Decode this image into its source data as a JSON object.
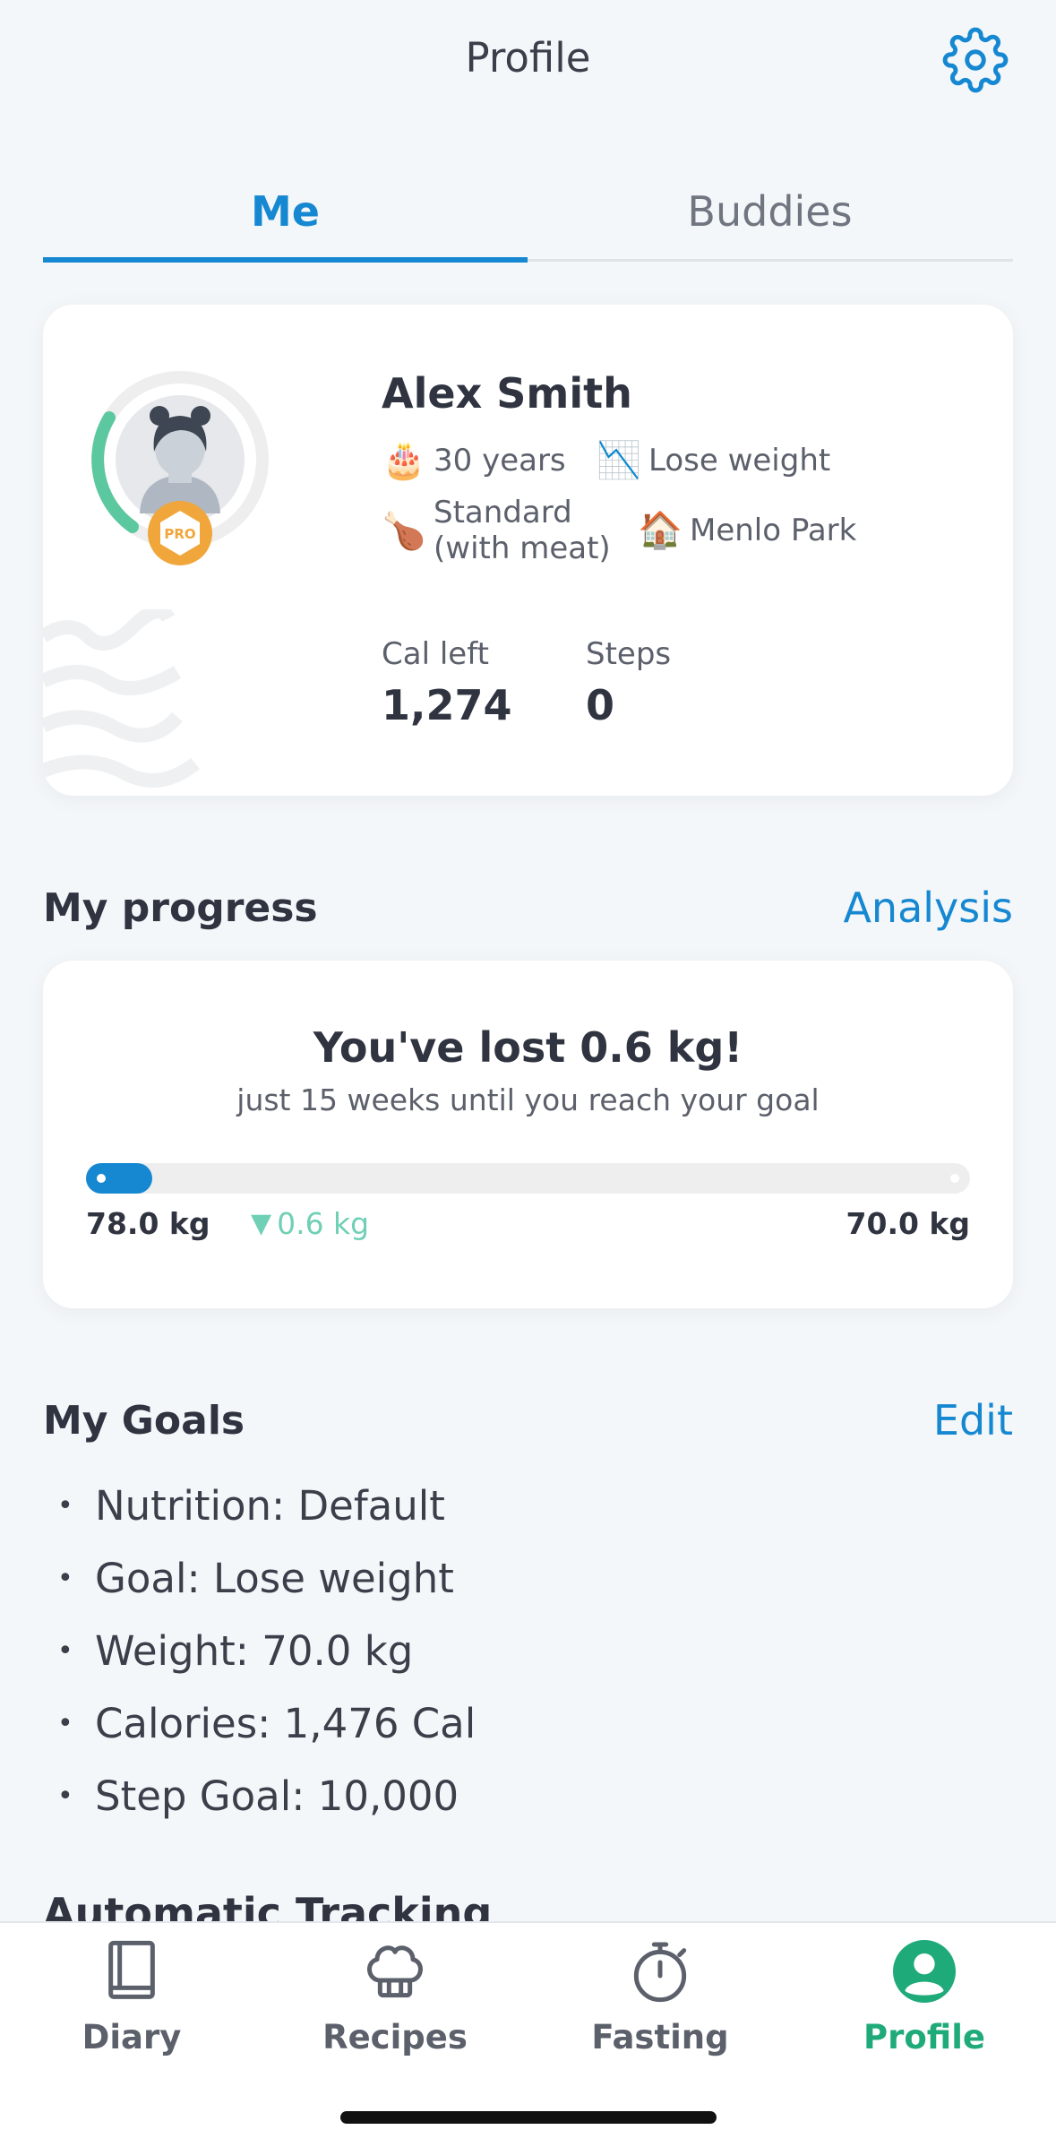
{
  "header": {
    "title": "Profile",
    "settings_icon": "gear-icon"
  },
  "tabs": [
    {
      "label": "Me",
      "active": true
    },
    {
      "label": "Buddies",
      "active": false
    }
  ],
  "profile": {
    "name": "Alex Smith",
    "badge": "PRO",
    "age": {
      "emoji": "🎂",
      "text": "30 years"
    },
    "goal": {
      "emoji": "📉",
      "text": "Lose weight"
    },
    "diet": {
      "emoji": "🍗",
      "line1": "Standard",
      "line2": "(with meat)"
    },
    "location": {
      "emoji": "🏠",
      "text": "Menlo Park"
    },
    "stats": [
      {
        "label": "Cal left",
        "value": "1,274"
      },
      {
        "label": "Steps",
        "value": "0"
      }
    ]
  },
  "progress": {
    "section_title": "My progress",
    "link": "Analysis",
    "headline": "You've lost 0.6 kg!",
    "subtitle": "just 15 weeks until you reach your goal",
    "start_weight": "78.0 kg",
    "delta": "0.6 kg",
    "target_weight": "70.0 kg",
    "progress_fraction": 0.075
  },
  "goals": {
    "section_title": "My Goals",
    "link": "Edit",
    "items": [
      "Nutrition: Default",
      "Goal: Lose weight",
      "Weight: 70.0 kg",
      "Calories: 1,476 Cal",
      "Step Goal: 10,000"
    ]
  },
  "next_section": {
    "title": "Automatic Tracking"
  },
  "tabbar": [
    {
      "label": "Diary",
      "icon": "book-icon",
      "active": false
    },
    {
      "label": "Recipes",
      "icon": "chef-hat-icon",
      "active": false
    },
    {
      "label": "Fasting",
      "icon": "stopwatch-icon",
      "active": false
    },
    {
      "label": "Profile",
      "icon": "user-icon",
      "active": true
    }
  ],
  "colors": {
    "accent": "#1688d1",
    "active_tab": "#1faa7a",
    "delta": "#6fd0b5",
    "pro_badge": "#f0a63a",
    "ring": "#5cc8a0"
  }
}
